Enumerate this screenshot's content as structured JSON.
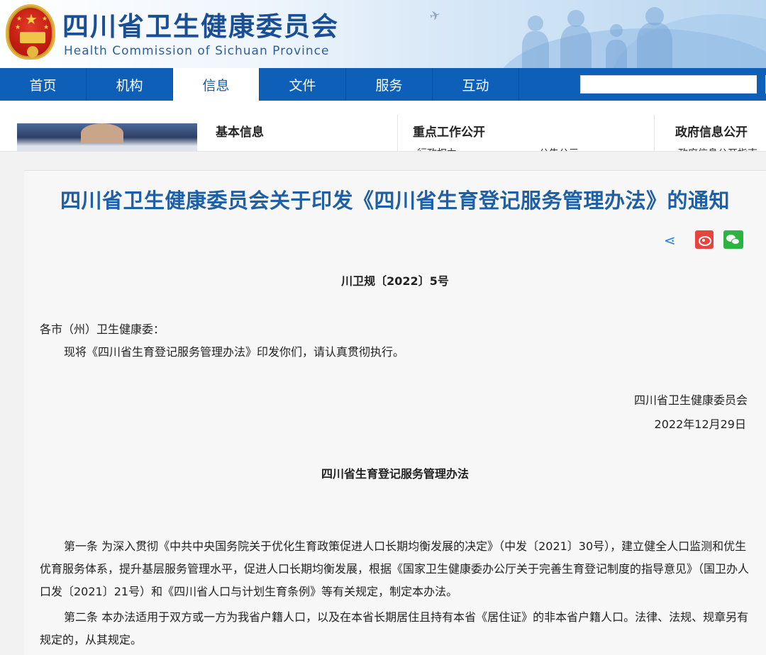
{
  "header": {
    "title_cn": "四川省卫生健康委员会",
    "title_en": "Health Commission of Sichuan Province",
    "emblem": "national-emblem-icon"
  },
  "nav": {
    "items": [
      {
        "label": "首页"
      },
      {
        "label": "机构"
      },
      {
        "label": "信息"
      },
      {
        "label": "文件"
      },
      {
        "label": "服务"
      },
      {
        "label": "互动"
      }
    ],
    "active_index": 2,
    "search_placeholder": ""
  },
  "dropdown": {
    "col1_head": "基本信息",
    "col2_head": "重点工作公开",
    "col2_sub1": "行政权力",
    "col2_sub2": "公告公示",
    "col3_head": "政府信息公开",
    "col3_sub1": "政府信息公开指南"
  },
  "article": {
    "title": "四川省卫生健康委员会关于印发《四川省生育登记服务管理办法》的通知",
    "doc_number": "川卫规〔2022〕5号",
    "addressee": "各市（州）卫生健康委：",
    "body": "现将《四川省生育登记服务管理办法》印发你们，请认真贯彻执行。",
    "signer": "四川省卫生健康委员会",
    "date": "2022年12月29日",
    "rule_title": "四川省生育登记服务管理办法",
    "article1": "第一条 为深入贯彻《中共中央国务院关于优化生育政策促进人口长期均衡发展的决定》（中发〔2021〕30号），建立健全人口监测和优生优育服务体系，提升基层服务管理水平，促进人口长期均衡发展，根据《国家卫生健康委办公厅关于完善生育登记制度的指导意见》（国卫办人口发〔2021〕21号）和《四川省人口与计划生育条例》等有关规定，制定本办法。",
    "article2": "第二条 本办法适用于双方或一方为我省户籍人口，以及在本省长期居住且持有本省《居住证》的非本省户籍人口。法律、法规、规章另有规定的，从其规定。"
  },
  "colors": {
    "nav_blue": "#0d5fb8",
    "title_blue": "#1f5fa6",
    "weibo_red": "#e6443c",
    "wechat_green": "#2db341"
  }
}
